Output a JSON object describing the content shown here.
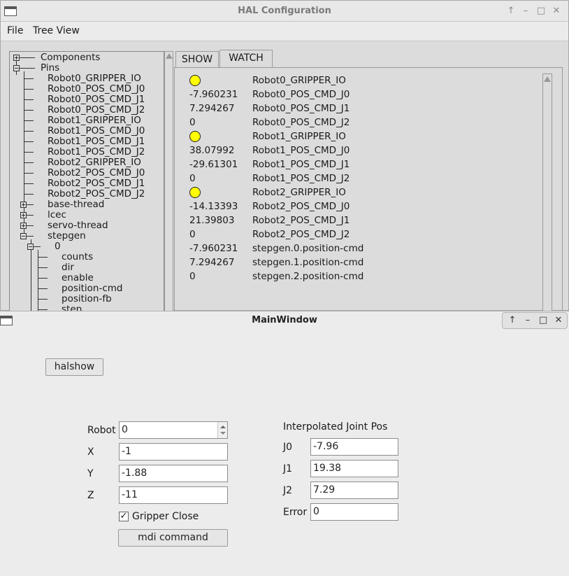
{
  "hal": {
    "title": "HAL Configuration",
    "controls": [
      "↑",
      "–",
      "□",
      "✕"
    ],
    "menu": [
      "File",
      "Tree View"
    ],
    "tree": {
      "components": "Components",
      "pins": "Pins",
      "pin_items": [
        "Robot0_GRIPPER_IO",
        "Robot0_POS_CMD_J0",
        "Robot0_POS_CMD_J1",
        "Robot0_POS_CMD_J2",
        "Robot1_GRIPPER_IO",
        "Robot1_POS_CMD_J0",
        "Robot1_POS_CMD_J1",
        "Robot1_POS_CMD_J2",
        "Robot2_GRIPPER_IO",
        "Robot2_POS_CMD_J0",
        "Robot2_POS_CMD_J1",
        "Robot2_POS_CMD_J2"
      ],
      "groups": [
        "base-thread",
        "lcec",
        "servo-thread",
        "stepgen"
      ],
      "stepgen_child": "0",
      "stepgen_pins": [
        "counts",
        "dir",
        "enable",
        "position-cmd",
        "position-fb",
        "step"
      ]
    },
    "tabs": [
      "SHOW",
      "WATCH"
    ],
    "active_tab": "WATCH",
    "watch": [
      {
        "value": "",
        "name": "Robot0_GRIPPER_IO",
        "led": true
      },
      {
        "value": "-7.960231",
        "name": "Robot0_POS_CMD_J0"
      },
      {
        "value": "7.294267",
        "name": "Robot0_POS_CMD_J1"
      },
      {
        "value": "0",
        "name": "Robot0_POS_CMD_J2"
      },
      {
        "value": "",
        "name": "Robot1_GRIPPER_IO",
        "led": true
      },
      {
        "value": "38.07992",
        "name": "Robot1_POS_CMD_J0"
      },
      {
        "value": "-29.61301",
        "name": "Robot1_POS_CMD_J1"
      },
      {
        "value": "0",
        "name": "Robot1_POS_CMD_J2"
      },
      {
        "value": "",
        "name": "Robot2_GRIPPER_IO",
        "led": true
      },
      {
        "value": "-14.13393",
        "name": "Robot2_POS_CMD_J0"
      },
      {
        "value": "21.39803",
        "name": "Robot2_POS_CMD_J1"
      },
      {
        "value": "0",
        "name": "Robot2_POS_CMD_J2"
      },
      {
        "value": "-7.960231",
        "name": "stepgen.0.position-cmd"
      },
      {
        "value": "7.294267",
        "name": "stepgen.1.position-cmd"
      },
      {
        "value": "0",
        "name": "stepgen.2.position-cmd"
      }
    ],
    "led_color": "#ffff00"
  },
  "main": {
    "title": "MainWindow",
    "controls": [
      "↑",
      "–",
      "□",
      "✕"
    ],
    "halshow_button": "halshow",
    "robot_label": "Robot",
    "robot_value": "0",
    "x_label": "X",
    "x_value": "-1",
    "y_label": "Y",
    "y_value": "-1.88",
    "z_label": "Z",
    "z_value": "-11",
    "gripper_label": "Gripper Close",
    "gripper_checked": true,
    "mdi_button": "mdi command",
    "interp_heading": "Interpolated Joint Pos",
    "j0_label": "J0",
    "j0_value": "-7.96",
    "j1_label": "J1",
    "j1_value": "19.38",
    "j2_label": "J2",
    "j2_value": "7.29",
    "error_label": "Error",
    "error_value": "0"
  }
}
